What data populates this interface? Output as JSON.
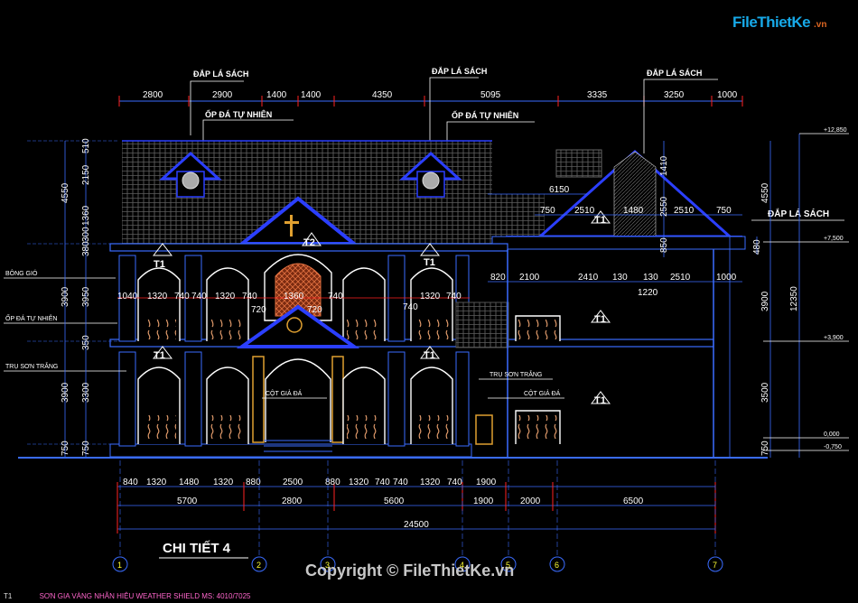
{
  "logo": {
    "brand": "FileThietKe",
    "suffix": ".vn"
  },
  "notes": {
    "dap_la_sach_1": "ĐẮP LÁ SÁCH",
    "dap_la_sach_2": "ĐẮP LÁ SÁCH",
    "dap_la_sach_3": "ĐẮP LÁ SÁCH",
    "dap_la_sach_right": "ĐẮP LÁ SÁCH",
    "op_da_1": "ỐP ĐÁ TỰ NHIÊN",
    "op_da_2": "ỐP ĐÁ TỰ NHIÊN",
    "op_da_left": "ỐP ĐÁ TỰ NHIÊN",
    "bong_gio": "BÔNG GIÓ",
    "tru_son_trang_left": "TRỤ SƠN TRẮNG",
    "tru_son_trang_right": "TRỤ SƠN TRẮNG",
    "cot_gia_da_1": "CỘT GIẢ ĐÁ",
    "cot_gia_da_2": "CỘT GIẢ ĐÁ"
  },
  "tags": {
    "t1": "T1",
    "t2": "T2"
  },
  "top_dims": [
    "2800",
    "2900",
    "1400",
    "1400",
    "4350",
    "5095",
    "3335",
    "3250",
    "1000"
  ],
  "bottom_dims_1": [
    "840",
    "1320",
    "1480",
    "1320",
    "880",
    "2500",
    "880",
    "1320",
    "740",
    "740",
    "1320",
    "740",
    "1900"
  ],
  "bottom_dims_2": [
    "5700",
    "2800",
    "5600",
    "1900",
    "2000",
    "6500"
  ],
  "total": "24500",
  "mid_dims_left": [
    "1040",
    "1320",
    "740",
    "740",
    "1320",
    "740",
    "1360",
    "740",
    "1320",
    "740"
  ],
  "mid_dims_small": [
    "720",
    "720",
    "740"
  ],
  "right_dims": [
    "6150",
    "750",
    "2510",
    "1480",
    "2510",
    "750"
  ],
  "right_dims_2": [
    "820",
    "2100",
    "2410",
    "130",
    "130",
    "2510",
    "1000"
  ],
  "dim_1220": "1220",
  "vert_left_1": [
    "510",
    "2150",
    "1360",
    "300",
    "380",
    "3950",
    "350",
    "3300",
    "750"
  ],
  "vert_left_2": [
    "4550",
    "3900",
    "3900",
    "750"
  ],
  "vert_right": [
    "1410",
    "2550",
    "850",
    "480",
    "4550",
    "3900",
    "3500",
    "750",
    "12350"
  ],
  "levels": [
    "+12,850",
    "+7,500",
    "+3,900",
    "0,000",
    "-0,750"
  ],
  "title": "CHI TIẾT 4",
  "grid_labels": [
    "1",
    "2",
    "3",
    "4",
    "5",
    "6",
    "7"
  ],
  "copyright": "Copyright © FileThietKe.vn",
  "footer": {
    "tag": "T1",
    "text": "SƠN GIA VÀNG NHÃN HIỆU WEATHER SHIELD MS: 4010/7025"
  }
}
